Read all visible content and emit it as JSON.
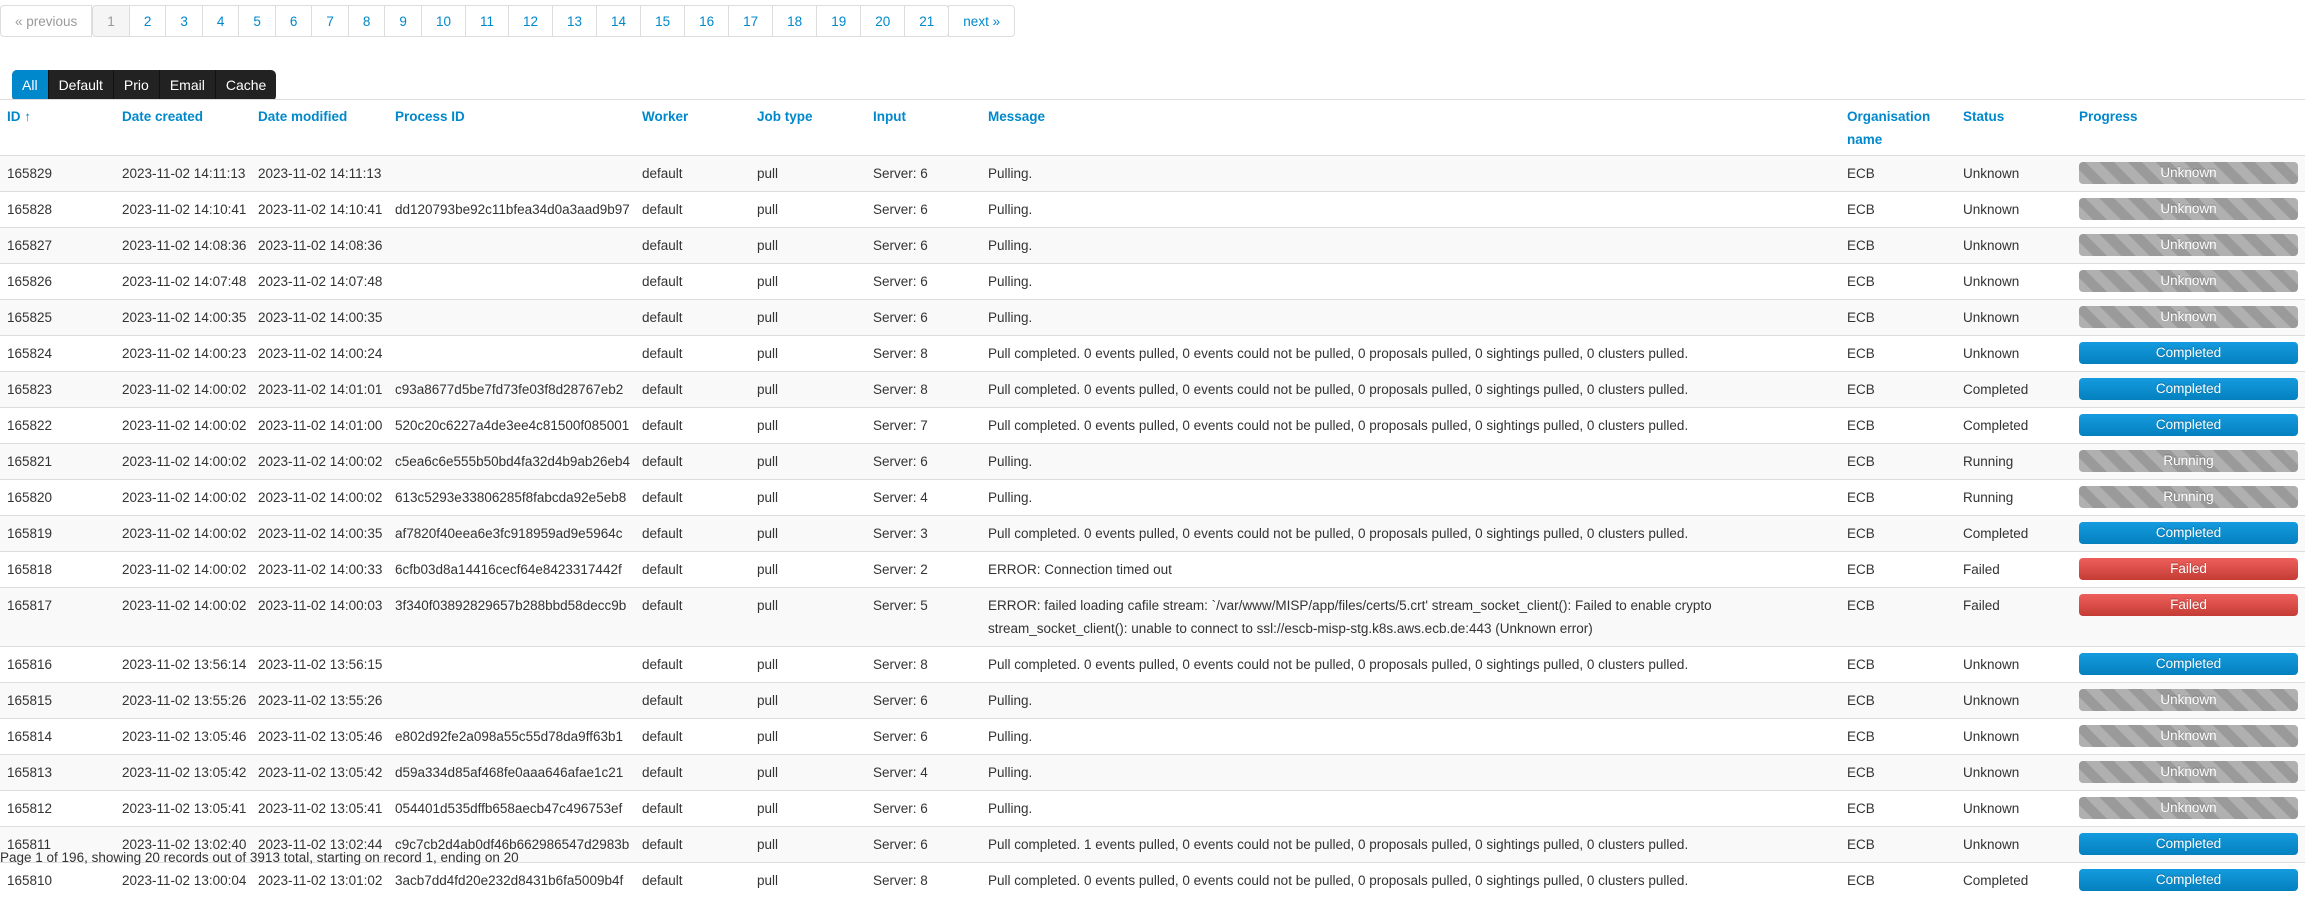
{
  "pagination": {
    "previous": "« previous",
    "pages": [
      "1",
      "2",
      "3",
      "4",
      "5",
      "6",
      "7",
      "8",
      "9",
      "10",
      "11",
      "12",
      "13",
      "14",
      "15",
      "16",
      "17",
      "18",
      "19",
      "20",
      "21"
    ],
    "current": "1",
    "next": "next »"
  },
  "filters": [
    "All",
    "Default",
    "Prio",
    "Email",
    "Cache"
  ],
  "active_filter": "All",
  "table": {
    "headers": {
      "id": "ID ↑",
      "date_created": "Date created",
      "date_modified": "Date modified",
      "process_id": "Process ID",
      "worker": "Worker",
      "job_type": "Job type",
      "input": "Input",
      "message": "Message",
      "organisation": "Organisation name",
      "status": "Status",
      "progress": "Progress"
    },
    "rows": [
      {
        "id": "165829",
        "created": "2023-11-02 14:11:13",
        "modified": "2023-11-02 14:11:13",
        "pid": "",
        "worker": "default",
        "type": "pull",
        "input": "Server: 6",
        "message": "Pulling.",
        "org": "ECB",
        "status": "Unknown",
        "progress": "Unknown"
      },
      {
        "id": "165828",
        "created": "2023-11-02 14:10:41",
        "modified": "2023-11-02 14:10:41",
        "pid": "dd120793be92c11bfea34d0a3aad9b97",
        "worker": "default",
        "type": "pull",
        "input": "Server: 6",
        "message": "Pulling.",
        "org": "ECB",
        "status": "Unknown",
        "progress": "Unknown"
      },
      {
        "id": "165827",
        "created": "2023-11-02 14:08:36",
        "modified": "2023-11-02 14:08:36",
        "pid": "",
        "worker": "default",
        "type": "pull",
        "input": "Server: 6",
        "message": "Pulling.",
        "org": "ECB",
        "status": "Unknown",
        "progress": "Unknown"
      },
      {
        "id": "165826",
        "created": "2023-11-02 14:07:48",
        "modified": "2023-11-02 14:07:48",
        "pid": "",
        "worker": "default",
        "type": "pull",
        "input": "Server: 6",
        "message": "Pulling.",
        "org": "ECB",
        "status": "Unknown",
        "progress": "Unknown"
      },
      {
        "id": "165825",
        "created": "2023-11-02 14:00:35",
        "modified": "2023-11-02 14:00:35",
        "pid": "",
        "worker": "default",
        "type": "pull",
        "input": "Server: 6",
        "message": "Pulling.",
        "org": "ECB",
        "status": "Unknown",
        "progress": "Unknown"
      },
      {
        "id": "165824",
        "created": "2023-11-02 14:00:23",
        "modified": "2023-11-02 14:00:24",
        "pid": "",
        "worker": "default",
        "type": "pull",
        "input": "Server: 8",
        "message": "Pull completed. 0 events pulled, 0 events could not be pulled, 0 proposals pulled, 0 sightings pulled, 0 clusters pulled.",
        "org": "ECB",
        "status": "Unknown",
        "progress": "Completed"
      },
      {
        "id": "165823",
        "created": "2023-11-02 14:00:02",
        "modified": "2023-11-02 14:01:01",
        "pid": "c93a8677d5be7fd73fe03f8d28767eb2",
        "worker": "default",
        "type": "pull",
        "input": "Server: 8",
        "message": "Pull completed. 0 events pulled, 0 events could not be pulled, 0 proposals pulled, 0 sightings pulled, 0 clusters pulled.",
        "org": "ECB",
        "status": "Completed",
        "progress": "Completed"
      },
      {
        "id": "165822",
        "created": "2023-11-02 14:00:02",
        "modified": "2023-11-02 14:01:00",
        "pid": "520c20c6227a4de3ee4c81500f085001",
        "worker": "default",
        "type": "pull",
        "input": "Server: 7",
        "message": "Pull completed. 0 events pulled, 0 events could not be pulled, 0 proposals pulled, 0 sightings pulled, 0 clusters pulled.",
        "org": "ECB",
        "status": "Completed",
        "progress": "Completed"
      },
      {
        "id": "165821",
        "created": "2023-11-02 14:00:02",
        "modified": "2023-11-02 14:00:02",
        "pid": "c5ea6c6e555b50bd4fa32d4b9ab26eb4",
        "worker": "default",
        "type": "pull",
        "input": "Server: 6",
        "message": "Pulling.",
        "org": "ECB",
        "status": "Running",
        "progress": "Running"
      },
      {
        "id": "165820",
        "created": "2023-11-02 14:00:02",
        "modified": "2023-11-02 14:00:02",
        "pid": "613c5293e33806285f8fabcda92e5eb8",
        "worker": "default",
        "type": "pull",
        "input": "Server: 4",
        "message": "Pulling.",
        "org": "ECB",
        "status": "Running",
        "progress": "Running"
      },
      {
        "id": "165819",
        "created": "2023-11-02 14:00:02",
        "modified": "2023-11-02 14:00:35",
        "pid": "af7820f40eea6e3fc918959ad9e5964c",
        "worker": "default",
        "type": "pull",
        "input": "Server: 3",
        "message": "Pull completed. 0 events pulled, 0 events could not be pulled, 0 proposals pulled, 0 sightings pulled, 0 clusters pulled.",
        "org": "ECB",
        "status": "Completed",
        "progress": "Completed"
      },
      {
        "id": "165818",
        "created": "2023-11-02 14:00:02",
        "modified": "2023-11-02 14:00:33",
        "pid": "6cfb03d8a14416cecf64e8423317442f",
        "worker": "default",
        "type": "pull",
        "input": "Server: 2",
        "message": "ERROR: Connection timed out",
        "org": "ECB",
        "status": "Failed",
        "progress": "Failed"
      },
      {
        "id": "165817",
        "created": "2023-11-02 14:00:02",
        "modified": "2023-11-02 14:00:03",
        "pid": "3f340f03892829657b288bbd58decc9b",
        "worker": "default",
        "type": "pull",
        "input": "Server: 5",
        "message": "ERROR: failed loading cafile stream: `/var/www/MISP/app/files/certs/5.crt' stream_socket_client(): Failed to enable crypto stream_socket_client(): unable to connect to ssl://escb-misp-stg.k8s.aws.ecb.de:443 (Unknown error)",
        "org": "ECB",
        "status": "Failed",
        "progress": "Failed"
      },
      {
        "id": "165816",
        "created": "2023-11-02 13:56:14",
        "modified": "2023-11-02 13:56:15",
        "pid": "",
        "worker": "default",
        "type": "pull",
        "input": "Server: 8",
        "message": "Pull completed. 0 events pulled, 0 events could not be pulled, 0 proposals pulled, 0 sightings pulled, 0 clusters pulled.",
        "org": "ECB",
        "status": "Unknown",
        "progress": "Completed"
      },
      {
        "id": "165815",
        "created": "2023-11-02 13:55:26",
        "modified": "2023-11-02 13:55:26",
        "pid": "",
        "worker": "default",
        "type": "pull",
        "input": "Server: 6",
        "message": "Pulling.",
        "org": "ECB",
        "status": "Unknown",
        "progress": "Unknown"
      },
      {
        "id": "165814",
        "created": "2023-11-02 13:05:46",
        "modified": "2023-11-02 13:05:46",
        "pid": "e802d92fe2a098a55c55d78da9ff63b1",
        "worker": "default",
        "type": "pull",
        "input": "Server: 6",
        "message": "Pulling.",
        "org": "ECB",
        "status": "Unknown",
        "progress": "Unknown"
      },
      {
        "id": "165813",
        "created": "2023-11-02 13:05:42",
        "modified": "2023-11-02 13:05:42",
        "pid": "d59a334d85af468fe0aaa646afae1c21",
        "worker": "default",
        "type": "pull",
        "input": "Server: 4",
        "message": "Pulling.",
        "org": "ECB",
        "status": "Unknown",
        "progress": "Unknown"
      },
      {
        "id": "165812",
        "created": "2023-11-02 13:05:41",
        "modified": "2023-11-02 13:05:41",
        "pid": "054401d535dffb658aecb47c496753ef",
        "worker": "default",
        "type": "pull",
        "input": "Server: 6",
        "message": "Pulling.",
        "org": "ECB",
        "status": "Unknown",
        "progress": "Unknown"
      },
      {
        "id": "165811",
        "created": "2023-11-02 13:02:40",
        "modified": "2023-11-02 13:02:44",
        "pid": "c9c7cb2d4ab0df46b662986547d2983b",
        "worker": "default",
        "type": "pull",
        "input": "Server: 6",
        "message": "Pull completed. 1 events pulled, 0 events could not be pulled, 0 proposals pulled, 0 sightings pulled, 0 clusters pulled.",
        "org": "ECB",
        "status": "Unknown",
        "progress": "Completed"
      },
      {
        "id": "165810",
        "created": "2023-11-02 13:00:04",
        "modified": "2023-11-02 13:01:02",
        "pid": "3acb7dd4fd20e232d8431b6fa5009b4f",
        "worker": "default",
        "type": "pull",
        "input": "Server: 8",
        "message": "Pull completed. 0 events pulled, 0 events could not be pulled, 0 proposals pulled, 0 sightings pulled, 0 clusters pulled.",
        "org": "ECB",
        "status": "Completed",
        "progress": "Completed"
      }
    ]
  },
  "footer": "Page 1 of 196, showing 20 records out of 3913 total, starting on record 1, ending on 20"
}
